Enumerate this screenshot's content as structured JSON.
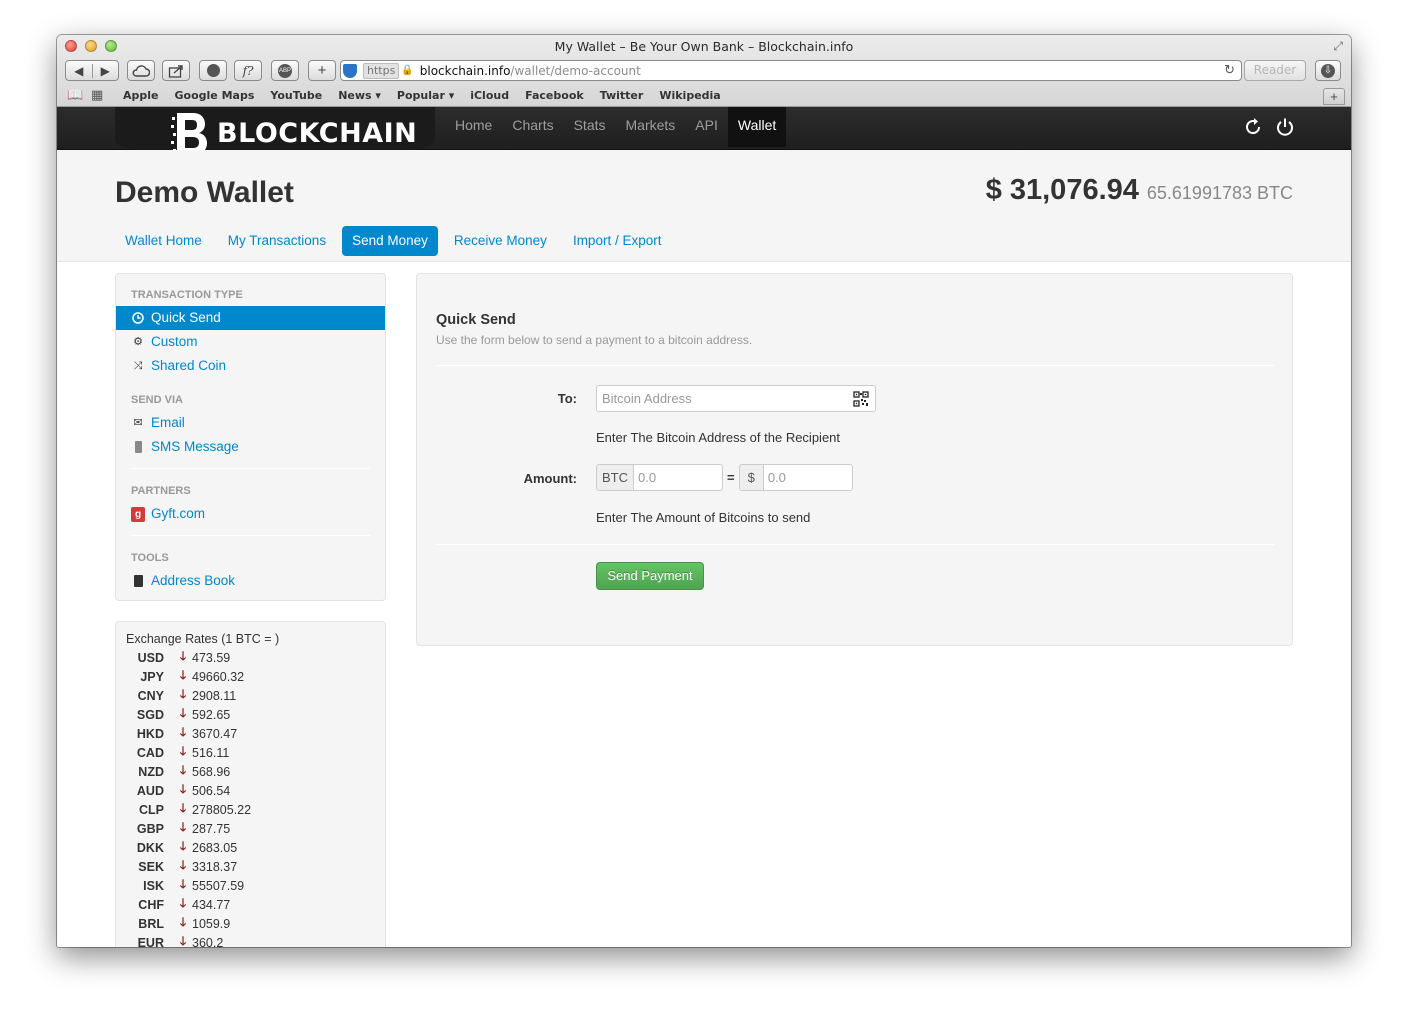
{
  "browser": {
    "window_title": "My Wallet – Be Your Own Bank – Blockchain.info",
    "url_scheme": "https",
    "url_host": "blockchain.info",
    "url_path": "/wallet/demo-account",
    "reader_label": "Reader",
    "bookmarks": [
      "Apple",
      "Google Maps",
      "YouTube",
      "News ▾",
      "Popular ▾",
      "iCloud",
      "Facebook",
      "Twitter",
      "Wikipedia"
    ]
  },
  "navbar": {
    "brand": "BLOCKCHAIN",
    "items": [
      {
        "label": "Home",
        "active": false
      },
      {
        "label": "Charts",
        "active": false
      },
      {
        "label": "Stats",
        "active": false
      },
      {
        "label": "Markets",
        "active": false
      },
      {
        "label": "API",
        "active": false
      },
      {
        "label": "Wallet",
        "active": true
      }
    ]
  },
  "header": {
    "title": "Demo Wallet",
    "balance_usd": "$ 31,076.94",
    "balance_btc": "65.61991783 BTC",
    "tabs": [
      {
        "label": "Wallet Home",
        "active": false
      },
      {
        "label": "My Transactions",
        "active": false
      },
      {
        "label": "Send Money",
        "active": true
      },
      {
        "label": "Receive Money",
        "active": false
      },
      {
        "label": "Import / Export",
        "active": false
      }
    ]
  },
  "sidebar": {
    "transaction_type_header": "Transaction Type",
    "transaction_types": [
      {
        "label": "Quick Send",
        "icon": "clock-icon",
        "active": true
      },
      {
        "label": "Custom",
        "icon": "gear-icon",
        "active": false
      },
      {
        "label": "Shared Coin",
        "icon": "shuffle-icon",
        "active": false
      }
    ],
    "send_via_header": "Send Via",
    "send_via": [
      {
        "label": "Email",
        "icon": "envelope-icon"
      },
      {
        "label": "SMS Message",
        "icon": "phone-icon"
      }
    ],
    "partners_header": "Partners",
    "partners": [
      {
        "label": "Gyft.com",
        "icon": "gyft-logo-icon"
      }
    ],
    "tools_header": "Tools",
    "tools": [
      {
        "label": "Address Book",
        "icon": "book-icon"
      }
    ]
  },
  "exchange_rates": {
    "title": "Exchange Rates (1 BTC = )",
    "rows": [
      {
        "currency": "USD",
        "value": "473.59"
      },
      {
        "currency": "JPY",
        "value": "49660.32"
      },
      {
        "currency": "CNY",
        "value": "2908.11"
      },
      {
        "currency": "SGD",
        "value": "592.65"
      },
      {
        "currency": "HKD",
        "value": "3670.47"
      },
      {
        "currency": "CAD",
        "value": "516.11"
      },
      {
        "currency": "NZD",
        "value": "568.96"
      },
      {
        "currency": "AUD",
        "value": "506.54"
      },
      {
        "currency": "CLP",
        "value": "278805.22"
      },
      {
        "currency": "GBP",
        "value": "287.75"
      },
      {
        "currency": "DKK",
        "value": "2683.05"
      },
      {
        "currency": "SEK",
        "value": "3318.37"
      },
      {
        "currency": "ISK",
        "value": "55507.59"
      },
      {
        "currency": "CHF",
        "value": "434.77"
      },
      {
        "currency": "BRL",
        "value": "1059.9"
      },
      {
        "currency": "EUR",
        "value": "360.2"
      }
    ]
  },
  "quick_send": {
    "title": "Quick Send",
    "subtitle": "Use the form below to send a payment to a bitcoin address.",
    "to_label": "To:",
    "address_placeholder": "Bitcoin Address",
    "address_help": "Enter The Bitcoin Address of the Recipient",
    "amount_label": "Amount:",
    "btc_addon": "BTC",
    "btc_placeholder": "0.0",
    "equals": "=",
    "usd_addon": "$",
    "usd_placeholder": "0.0",
    "amount_help": "Enter The Amount of Bitcoins to send",
    "send_button": "Send Payment"
  },
  "colors": {
    "accent": "#0088cc",
    "navbar": "#222222",
    "send_button": "#5bb75b",
    "down_arrow": "#8a1a1a"
  }
}
